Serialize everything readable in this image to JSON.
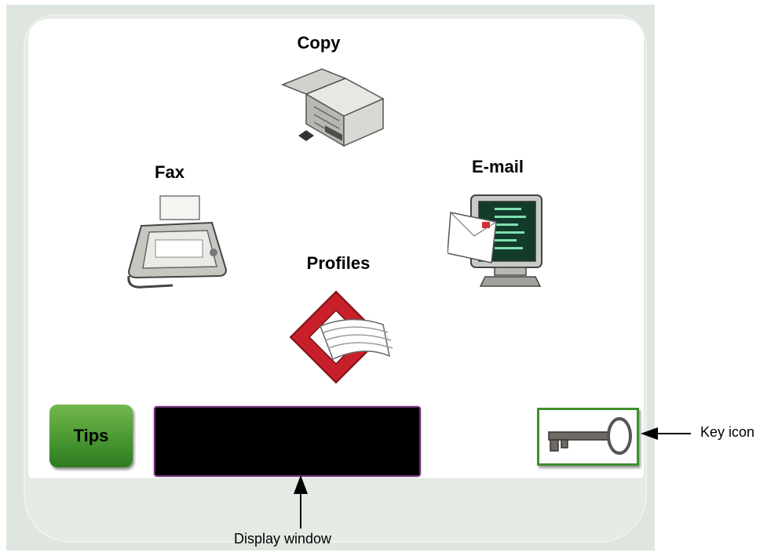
{
  "menu": {
    "copy_label": "Copy",
    "fax_label": "Fax",
    "email_label": "E-mail",
    "profiles_label": "Profiles",
    "tips_label": "Tips"
  },
  "callouts": {
    "key_icon": "Key icon",
    "display_window": "Display window"
  },
  "colors": {
    "tips_green": "#3f8f2b",
    "profiles_red": "#c8202a",
    "display_border": "#6a2f6f"
  },
  "icons": [
    "copier-icon",
    "fax-icon",
    "email-monitor-icon",
    "profiles-icon",
    "key-icon"
  ]
}
